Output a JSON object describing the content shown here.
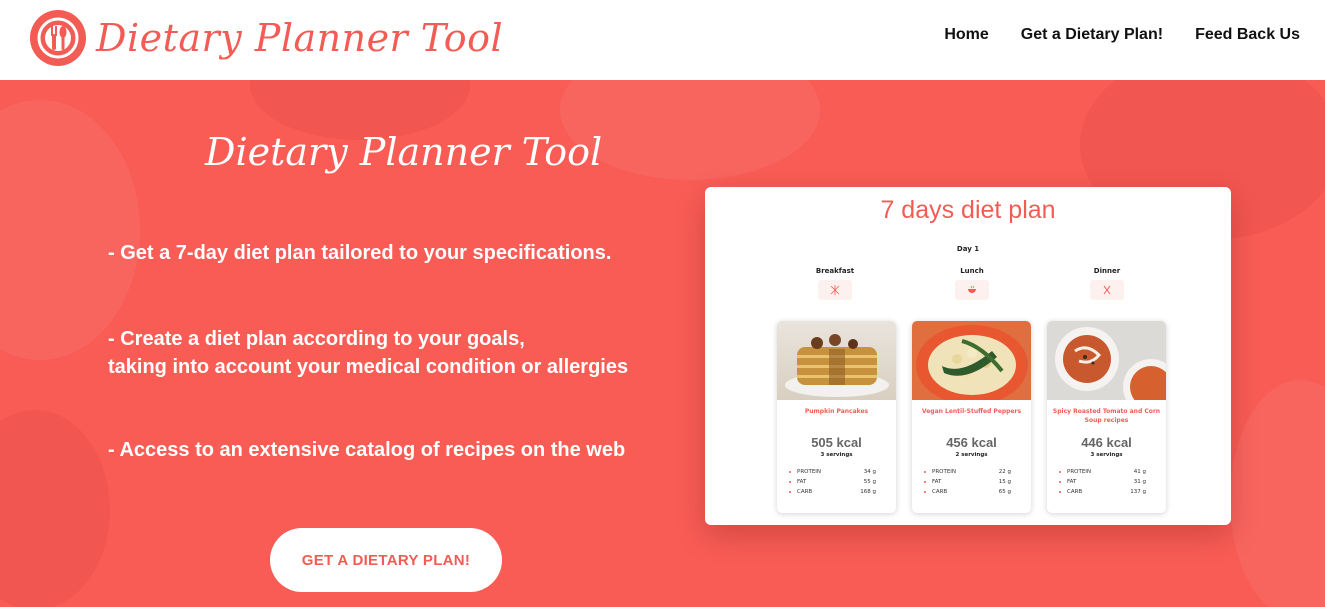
{
  "brand": {
    "name": "Dietary Planner Tool",
    "accent": "#f25c54"
  },
  "nav": {
    "items": [
      "Home",
      "Get a Dietary Plan!",
      "Feed Back Us"
    ]
  },
  "hero": {
    "title": "Dietary Planner Tool",
    "features": [
      "- Get a 7-day diet plan tailored to your specifications.",
      "- Create a diet plan according to your goals,",
      "taking into account your medical condition or allergies",
      "- Access to an extensive catalog of recipes on the web"
    ],
    "cta": "GET A DIETARY PLAN!",
    "background": "#f85c55"
  },
  "preview": {
    "title": "7 days diet plan",
    "day": "Day 1",
    "meals": [
      {
        "label": "Breakfast",
        "icon": "utensils-icon"
      },
      {
        "label": "Lunch",
        "icon": "soup-bowl-icon"
      },
      {
        "label": "Dinner",
        "icon": "fork-knife-icon"
      }
    ],
    "recipes": [
      {
        "name": "Pumpkin Pancakes",
        "kcal": "505 kcal",
        "servings": "3 servings",
        "nutrients": [
          {
            "name": "PROTEIN",
            "value": "34 g"
          },
          {
            "name": "FAT",
            "value": "55 g"
          },
          {
            "name": "CARB",
            "value": "168 g"
          }
        ]
      },
      {
        "name": "Vegan Lentil-Stuffed Peppers",
        "kcal": "456 kcal",
        "servings": "2 servings",
        "nutrients": [
          {
            "name": "PROTEIN",
            "value": "22 g"
          },
          {
            "name": "FAT",
            "value": "15 g"
          },
          {
            "name": "CARB",
            "value": "65 g"
          }
        ]
      },
      {
        "name": "Spicy Roasted Tomato and Corn Soup recipes",
        "kcal": "446 kcal",
        "servings": "3 servings",
        "nutrients": [
          {
            "name": "PROTEIN",
            "value": "41 g"
          },
          {
            "name": "FAT",
            "value": "31 g"
          },
          {
            "name": "CARB",
            "value": "137 g"
          }
        ]
      }
    ]
  }
}
